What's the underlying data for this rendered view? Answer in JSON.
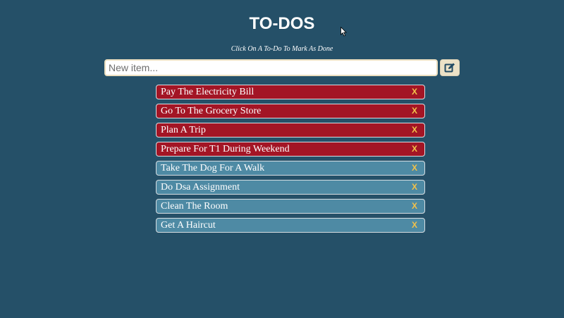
{
  "header": {
    "title": "TO-DOS",
    "subtitle": "Click On A To-Do To Mark As Done"
  },
  "input": {
    "placeholder": "New item...",
    "value": "",
    "add_icon": "pencil-square-icon"
  },
  "todos": [
    {
      "text": "Pay The Electricity Bill",
      "status": "pending",
      "delete_label": "X"
    },
    {
      "text": "Go To The Grocery Store",
      "status": "pending",
      "delete_label": "X"
    },
    {
      "text": "Plan A Trip",
      "status": "pending",
      "delete_label": "X"
    },
    {
      "text": "Prepare For T1 During Weekend",
      "status": "pending",
      "delete_label": "X"
    },
    {
      "text": "Take The Dog For A Walk",
      "status": "done",
      "delete_label": "X"
    },
    {
      "text": "Do Dsa Assignment",
      "status": "done",
      "delete_label": "X"
    },
    {
      "text": "Clean The Room",
      "status": "done",
      "delete_label": "X"
    },
    {
      "text": "Get A Haircut",
      "status": "done",
      "delete_label": "X"
    }
  ],
  "colors": {
    "background": "#255068",
    "pending": "#a31525",
    "done": "#4e8aa4",
    "delete": "#f2c14a",
    "button": "#ece2c7"
  }
}
